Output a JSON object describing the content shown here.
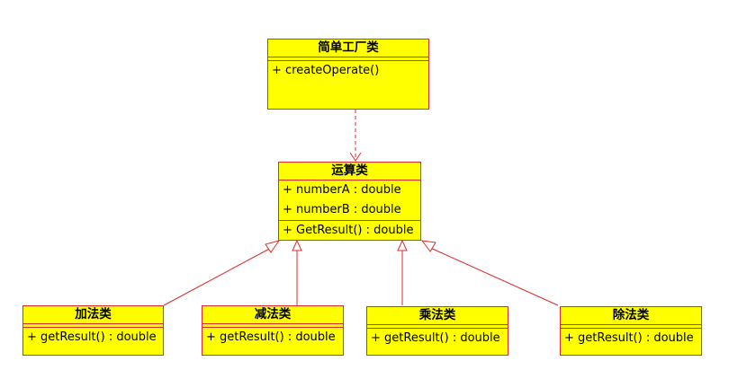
{
  "factory": {
    "name": "简单工厂类",
    "methods": [
      "+ createOperate()"
    ]
  },
  "operation": {
    "name": "运算类",
    "attributes": [
      "+ numberA : double",
      "+ numberB : double"
    ],
    "methods": [
      "+ GetResult() : double"
    ]
  },
  "subclasses": [
    {
      "name": "加法类",
      "method": "+ getResult() : double"
    },
    {
      "name": "减法类",
      "method": "+ getResult() : double"
    },
    {
      "name": "乘法类",
      "method": "+ getResult() : double"
    },
    {
      "name": "除法类",
      "method": "+ getResult() : double"
    }
  ],
  "colors": {
    "fill": "#ffff00",
    "stroke": "#e0292b"
  }
}
